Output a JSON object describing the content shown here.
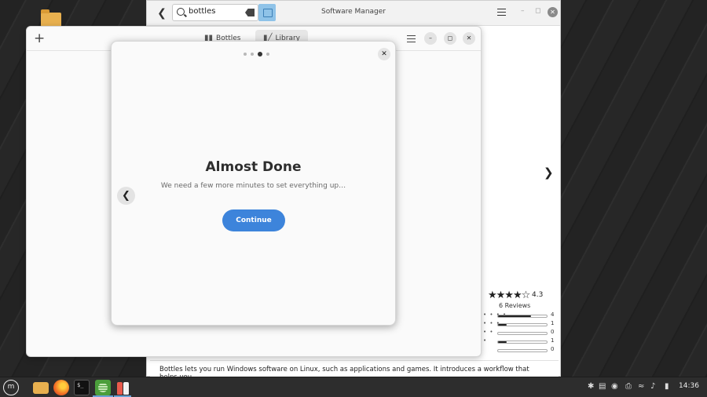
{
  "software_manager": {
    "title": "Software Manager",
    "search_value": "bottles",
    "rating": {
      "stars": "★★★★☆",
      "score": "4.3",
      "reviews": "6 Reviews",
      "bars": [
        {
          "fraction": 0.67,
          "count": "4"
        },
        {
          "fraction": 0.17,
          "count": "1"
        },
        {
          "fraction": 0.0,
          "count": "0"
        },
        {
          "fraction": 0.17,
          "count": "1"
        },
        {
          "fraction": 0.0,
          "count": "0"
        }
      ]
    },
    "description": "Bottles lets you run Windows software on Linux, such as applications and games. It introduces a workflow that helps you"
  },
  "bottles": {
    "tabs": [
      {
        "label": "Bottles"
      },
      {
        "label": "Library"
      }
    ]
  },
  "dialog": {
    "title": "Almost Done",
    "subtitle": "We need a few more minutes to set everything up…",
    "continue_label": "Continue",
    "pages": 4,
    "current_page": 3
  },
  "taskbar": {
    "clock": "14:36"
  }
}
